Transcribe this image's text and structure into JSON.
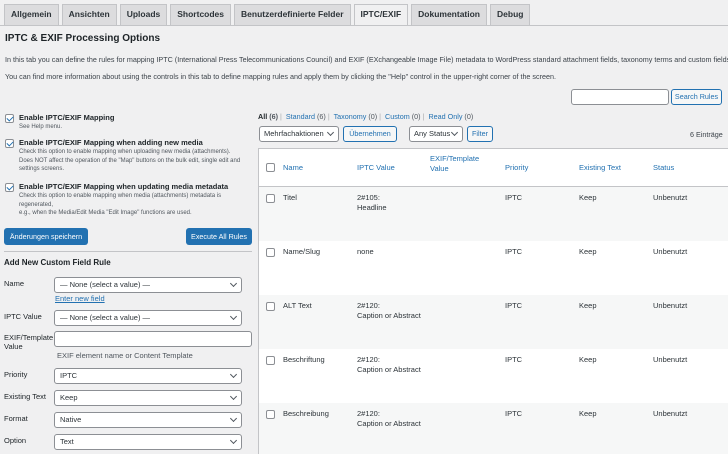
{
  "tabs": [
    {
      "label": "Allgemein",
      "active": false
    },
    {
      "label": "Ansichten",
      "active": false
    },
    {
      "label": "Uploads",
      "active": false
    },
    {
      "label": "Shortcodes",
      "active": false
    },
    {
      "label": "Benutzerdefinierte Felder",
      "active": false
    },
    {
      "label": "IPTC/EXIF",
      "active": true
    },
    {
      "label": "Dokumentation",
      "active": false
    },
    {
      "label": "Debug",
      "active": false
    }
  ],
  "heading": "IPTC & EXIF Processing Options",
  "intro": [
    "In this tab you can define the rules for mapping IPTC (International Press Telecommunications Council) and EXIF (EXchangeable Image File) metadata to WordPress standard attachment fields, taxonomy terms and custom fields.",
    "You can find more information about using the controls in this tab to define mapping rules and apply them by clicking the \"Help\" control in the upper-right corner of the screen."
  ],
  "search": {
    "placeholder": "",
    "button": "Search Rules"
  },
  "options": [
    {
      "title": "Enable IPTC/EXIF Mapping",
      "checked": true,
      "desc": [
        "See Help menu."
      ]
    },
    {
      "title": "Enable IPTC/EXIF Mapping when adding new media",
      "checked": true,
      "desc": [
        "Check this option to enable mapping when uploading new media (attachments).",
        "Does NOT affect the operation of the \"Map\" buttons on the bulk edit, single edit and",
        "settings screens."
      ]
    },
    {
      "title": "Enable IPTC/EXIF Mapping when updating media metadata",
      "checked": true,
      "desc": [
        "Check this option to enable mapping when media (attachments) metadata is",
        "regenerated,",
        "e.g., when the Media/Edit Media \"Edit Image\" functions are used."
      ]
    }
  ],
  "buttons": {
    "save": "Änderungen speichern",
    "execute": "Execute All Rules"
  },
  "form": {
    "title": "Add New Custom Field Rule",
    "name_label": "Name",
    "name_value": "— None (select a value) —",
    "enter_new_field": "Enter new field",
    "iptc_label": "IPTC Value",
    "iptc_value": "— None (select a value) —",
    "exif_label": [
      "EXIF/Template",
      "Value"
    ],
    "exif_hint": "EXIF element name or Content Template",
    "priority_label": "Priority",
    "priority_value": "IPTC",
    "existing_label": "Existing Text",
    "existing_value": "Keep",
    "format_label": "Format",
    "format_value": "Native",
    "option_label": "Option",
    "option_value": "Text"
  },
  "views": [
    {
      "label": "All",
      "count": "(6)",
      "current": true
    },
    {
      "label": "Standard",
      "count": "(6)",
      "current": false
    },
    {
      "label": "Taxonomy",
      "count": "(0)",
      "current": false
    },
    {
      "label": "Custom",
      "count": "(0)",
      "current": false
    },
    {
      "label": "Read Only",
      "count": "(0)",
      "current": false
    }
  ],
  "bulk": {
    "select": "Mehrfachaktionen",
    "apply": "Übernehmen",
    "status": "Any Status",
    "filter": "Filter",
    "count": "6 Einträge"
  },
  "table": {
    "columns": [
      "Name",
      "IPTC Value",
      "EXIF/Template Value",
      "Priority",
      "Existing Text",
      "Status"
    ],
    "rows": [
      {
        "name": "Titel",
        "iptc": [
          "2#105:",
          "Headline"
        ],
        "priority": "IPTC",
        "existing": "Keep",
        "status": "Unbenutzt"
      },
      {
        "name": "Name/Slug",
        "iptc": [
          "none"
        ],
        "priority": "IPTC",
        "existing": "Keep",
        "status": "Unbenutzt"
      },
      {
        "name": "ALT Text",
        "iptc": [
          "2#120:",
          "Caption or Abstract"
        ],
        "priority": "IPTC",
        "existing": "Keep",
        "status": "Unbenutzt"
      },
      {
        "name": "Beschriftung",
        "iptc": [
          "2#120:",
          "Caption or Abstract"
        ],
        "priority": "IPTC",
        "existing": "Keep",
        "status": "Unbenutzt"
      },
      {
        "name": "Beschreibung",
        "iptc": [
          "2#120:",
          "Caption or Abstract"
        ],
        "priority": "IPTC",
        "existing": "Keep",
        "status": "Unbenutzt"
      }
    ]
  }
}
